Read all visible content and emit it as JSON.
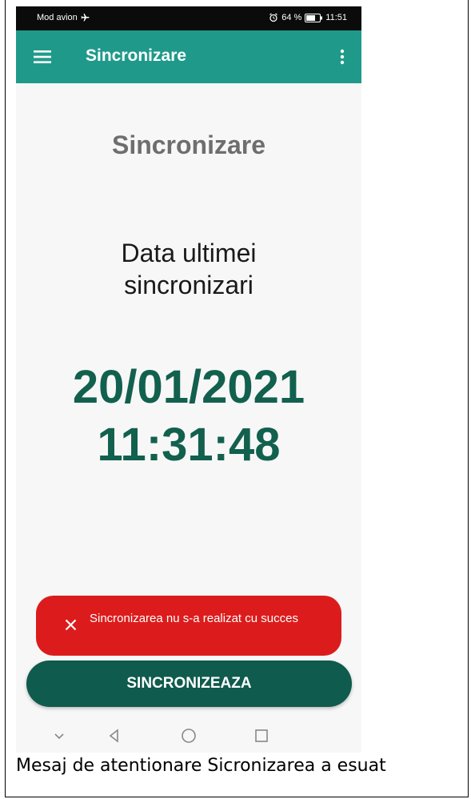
{
  "status_bar": {
    "left_text": "Mod avion",
    "battery_text": "64 %",
    "time": "11:51"
  },
  "app_bar": {
    "title": "Sincronizare"
  },
  "main": {
    "heading": "Sincronizare",
    "subheading": "Data ultimei sincronizari",
    "last_sync_date": "20/01/2021",
    "last_sync_time": "11:31:48"
  },
  "snackbar": {
    "message": "Sincronizarea nu s-a realizat cu succes"
  },
  "actions": {
    "sync_label": "SINCRONIZEAZA"
  },
  "caption": {
    "text": "Mesaj de atentionare Sicronizarea a esuat"
  },
  "colors": {
    "app_bar": "#1f9a8a",
    "accent_dark": "#12604e",
    "error": "#dc1c1c",
    "button": "#0f5b4d"
  }
}
